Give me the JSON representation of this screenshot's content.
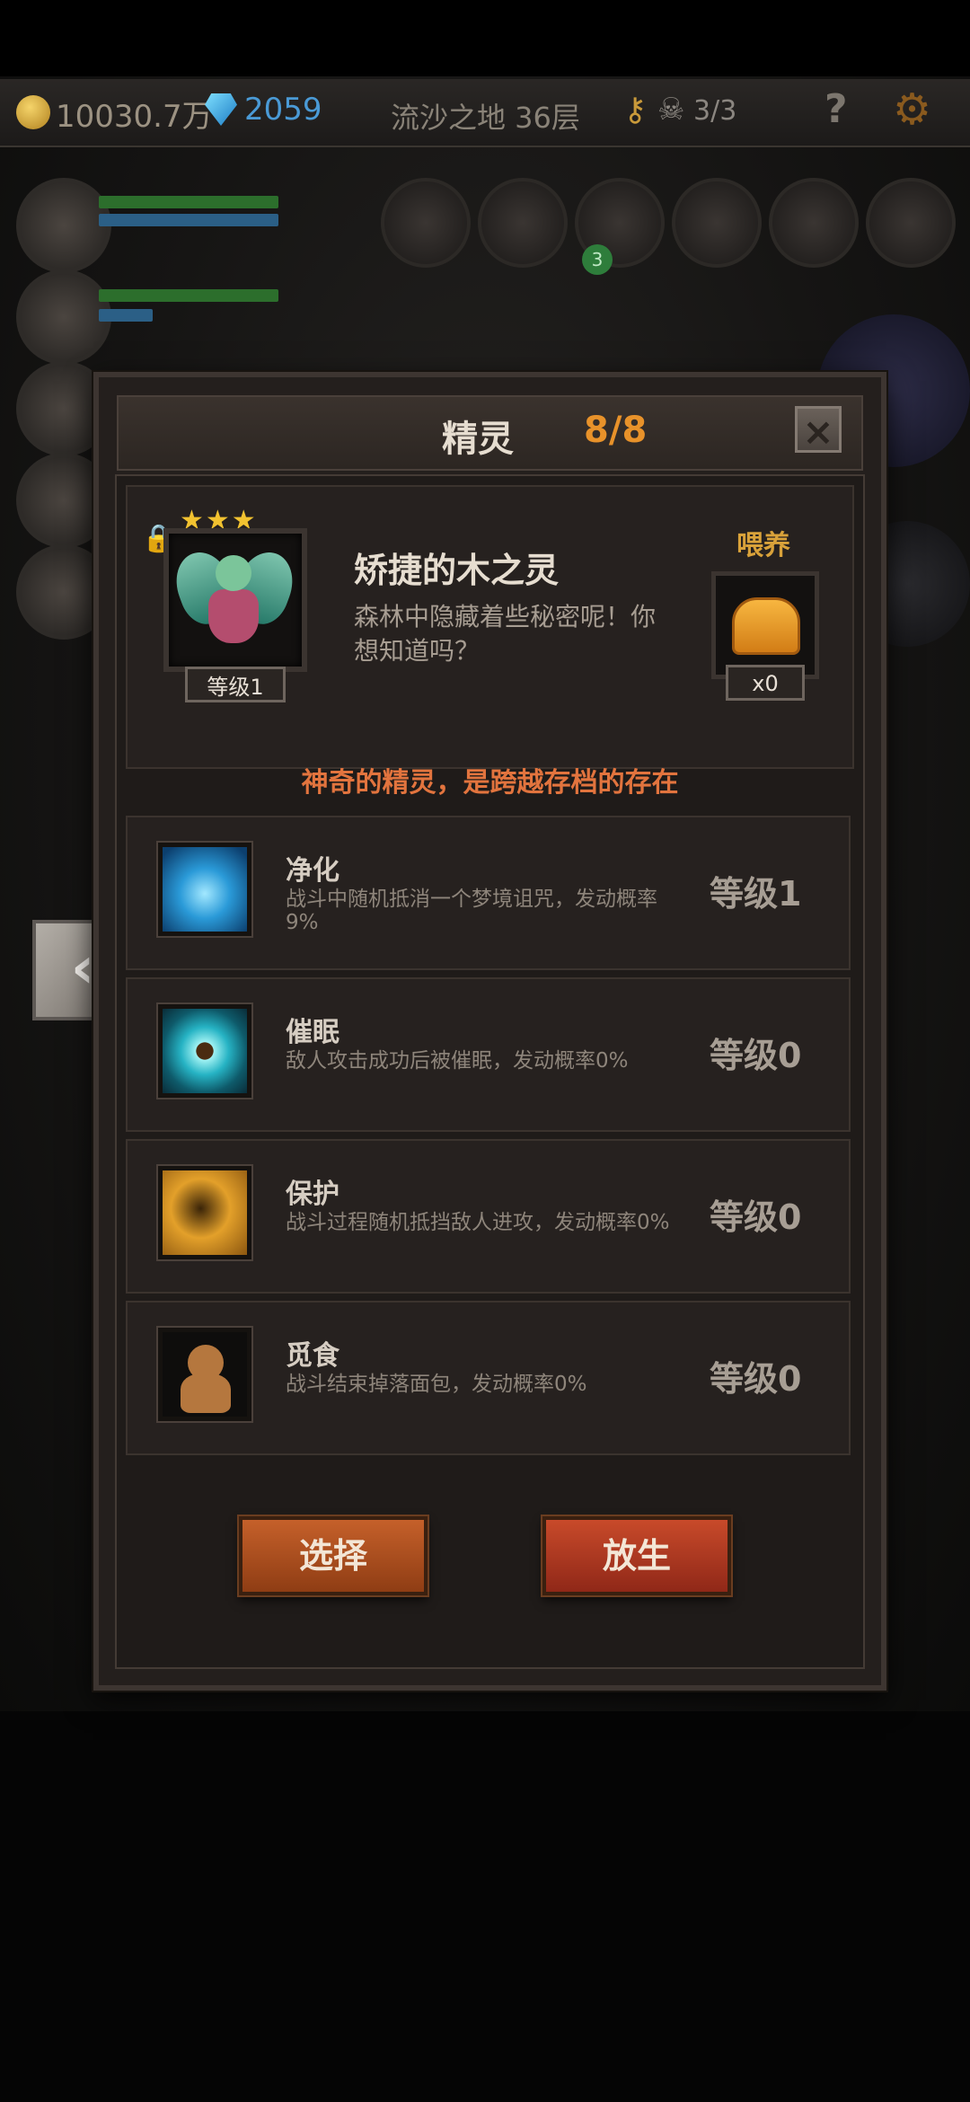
{
  "hud": {
    "gold": "10030.7万",
    "gems": "2059",
    "floor": "流沙之地 36层",
    "skulls": "3/3",
    "help": "?",
    "badge": "3"
  },
  "dialog": {
    "title": "精灵",
    "count": "8/8",
    "close": "×"
  },
  "spirit": {
    "stars": "★★★",
    "name": "矫捷的木之灵",
    "description": "森林中隐藏着些秘密呢！你想知道吗？",
    "level": "等级1",
    "feed_label": "喂养",
    "feed_count": "x0",
    "tagline": "神奇的精灵，是跨越存档的存在"
  },
  "skills": [
    {
      "name": "净化",
      "desc": "战斗中随机抵消一个梦境诅咒，发动概率9%",
      "level": "等级1"
    },
    {
      "name": "催眠",
      "desc": "敌人攻击成功后被催眠，发动概率0%",
      "level": "等级0"
    },
    {
      "name": "保护",
      "desc": "战斗过程随机抵挡敌人进攻，发动概率0%",
      "level": "等级0"
    },
    {
      "name": "觅食",
      "desc": "战斗结束掉落面包，发动概率0%",
      "level": "等级0"
    }
  ],
  "buttons": {
    "select": "选择",
    "release": "放生",
    "prev": "‹"
  }
}
